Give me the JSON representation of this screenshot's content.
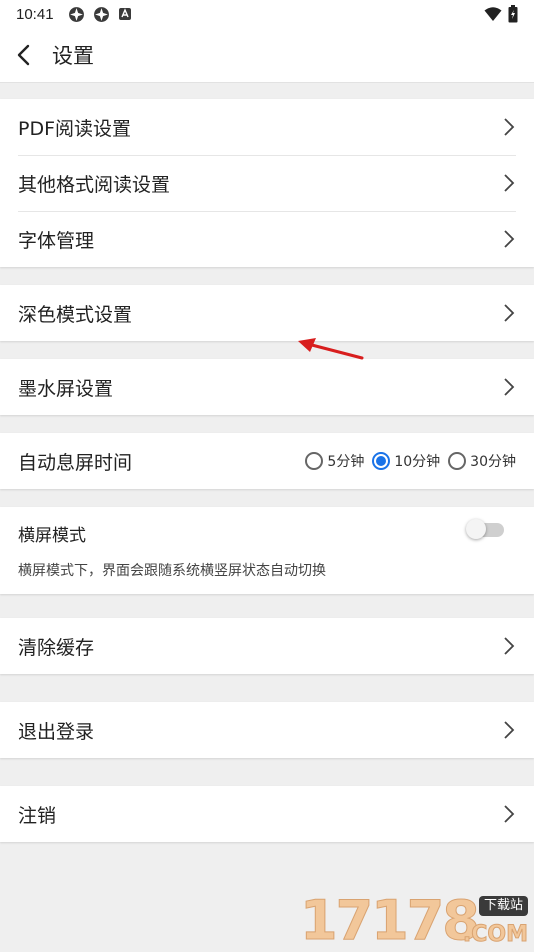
{
  "status_bar": {
    "time": "10:41",
    "left_icons": [
      "notification-icon-1",
      "notification-icon-2",
      "app-icon"
    ],
    "right_icons": [
      "wifi-icon",
      "battery-icon"
    ]
  },
  "header": {
    "title": "设置",
    "back_icon": "back-arrow-icon"
  },
  "sections": {
    "reading": {
      "items": [
        {
          "label": "PDF阅读设置"
        },
        {
          "label": "其他格式阅读设置"
        },
        {
          "label": "字体管理"
        }
      ]
    },
    "dark_mode": {
      "label": "深色模式设置"
    },
    "eink": {
      "label": "墨水屏设置"
    },
    "screen_timeout": {
      "label": "自动息屏时间",
      "options": [
        {
          "label": "5分钟",
          "selected": false
        },
        {
          "label": "10分钟",
          "selected": true
        },
        {
          "label": "30分钟",
          "selected": false
        }
      ]
    },
    "landscape": {
      "title": "横屏模式",
      "description": "横屏模式下，界面会跟随系统横竖屏状态自动切换",
      "enabled": false
    },
    "clear_cache": {
      "label": "清除缓存"
    },
    "logout": {
      "label": "退出登录"
    },
    "deregister": {
      "label": "注销"
    }
  },
  "watermark": {
    "digits": "17178",
    "badge": "下载站",
    "suffix": ".COM"
  },
  "colors": {
    "accent": "#1a73e8",
    "background": "#efefef",
    "annotation_arrow": "#d81e1e"
  }
}
